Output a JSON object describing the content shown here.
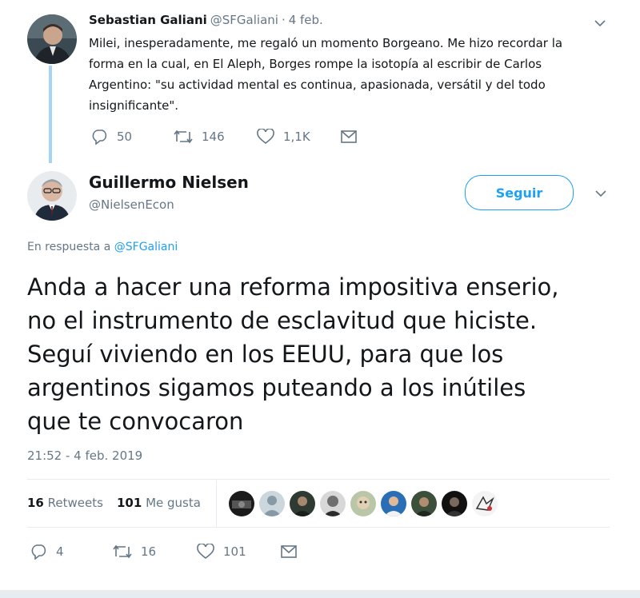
{
  "parent_tweet": {
    "author_name": "Sebastian Galiani",
    "handle": "@SFGaliani",
    "separator": "·",
    "date": "4 feb.",
    "text_lines": [
      "Milei, inesperadamente, me regaló un momento Borgeano. Me hizo recordar la",
      "forma en la cual, en El Aleph, Borges rompe la isotopía al escribir de Carlos",
      "Argentino: \"su actividad mental es continua, apasionada, versátil y del todo",
      "insignificante\"."
    ],
    "replies": "50",
    "retweets": "146",
    "likes": "1,1K",
    "icons": {
      "reply": "reply-icon",
      "retweet": "retweet-icon",
      "like": "heart-icon",
      "dm": "mail-icon",
      "menu": "chevron-down-icon"
    }
  },
  "main_tweet": {
    "author_name": "Guillermo Nielsen",
    "handle": "@NielsenEcon",
    "follow_label": "Seguir",
    "reply_prefix": "En respuesta a",
    "reply_to": "@SFGaliani",
    "text_lines": [
      "Anda a hacer una reforma impositiva enserio,",
      "no el instrumento de esclavitud que hiciste.",
      "Seguí viviendo en los EEUU, para que los",
      "argentinos sigamos puteando a los inútiles",
      "que te convocaron"
    ],
    "timestamp": "21:52 - 4 feb. 2019",
    "retweet_count": "16",
    "retweet_label": "Retweets",
    "like_count": "101",
    "like_label": "Me gusta",
    "actions": {
      "replies": "4",
      "retweets": "16",
      "likes": "101"
    }
  },
  "colors": {
    "accent": "#1da1f2",
    "muted": "#657786",
    "divider": "#e6ecf0",
    "thread_line": "#a6d4f7"
  }
}
